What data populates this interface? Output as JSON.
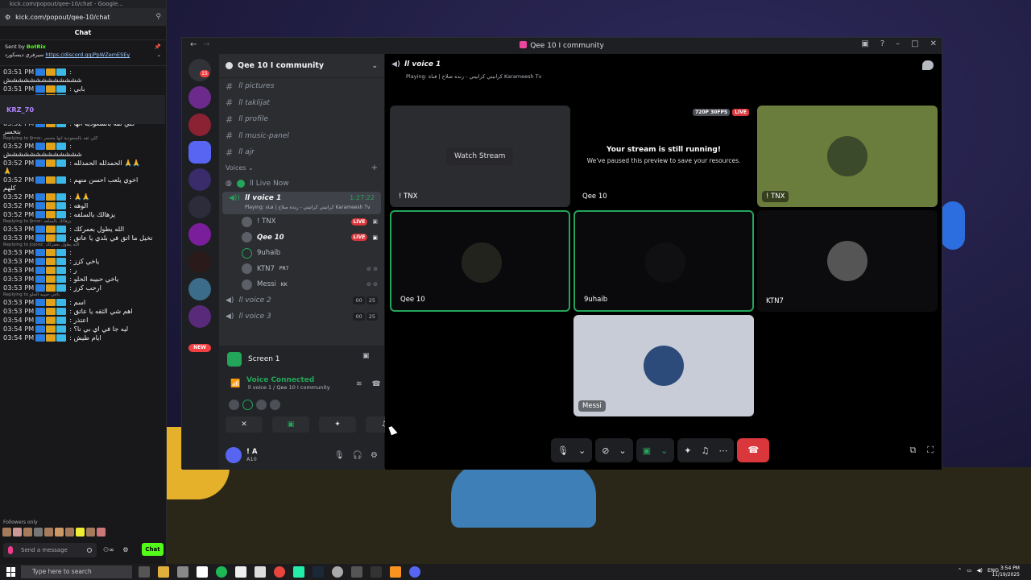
{
  "browser": {
    "title": "kick.com/popout/qee-10/chat - Google...",
    "url": "kick.com/popout/qee-10/chat"
  },
  "kick_chat": {
    "header": "Chat",
    "pinned_sender": "Sent by",
    "pinned_bot": "BotRix",
    "pinned_text": "سيرفري ديسكورد",
    "pinned_link": "https://discord.gg/PpWZemESEy",
    "messages": [
      {
        "time": "03:51 PM",
        "user": "Jojooz",
        "color": "#3aa0ff",
        "text": ":",
        "cont": "ششششششششششششش"
      },
      {
        "time": "03:51 PM",
        "user": "Jojooz",
        "color": "#3aa0ff",
        "text": ": بابي"
      },
      {
        "time": "03:51 PM",
        "user": "IJnno",
        "color": "#ffffff",
        "text": ": !!"
      },
      {
        "time": "03:51 PM",
        "user": "Jojooz",
        "color": "#3aa0ff",
        "text": ": ارحبي",
        "cont": "شششششششششششششش"
      },
      {
        "time": "03:52 PM",
        "user": "IJnno",
        "color": "#ffffff",
        "text": ": كلي ثقه بالسعودية انها",
        "cont": "بتخسر"
      },
      {
        "reply": "Replying to IJnno: كلي ثقه بالسعودية انها بتخسر",
        "time": "03:52 PM",
        "user": "Jojooz",
        "color": "#3aa0ff",
        "text": ":",
        "cont": "ششششششششششششش"
      },
      {
        "time": "03:52 PM",
        "user": "IJnno",
        "color": "#ffffff",
        "text": ": الحمدلله الحمدلله 🙏🙏",
        "cont": "🙏"
      },
      {
        "time": "03:52 PM",
        "user": "IJnno",
        "color": "#ffffff",
        "text": ": اخوي يلعب احسن منهم",
        "cont": "كلهم"
      },
      {
        "time": "03:52 PM",
        "user": "IJnno",
        "color": "#ffffff",
        "text": ": 🙏🙏"
      },
      {
        "time": "03:52 PM",
        "user": "Jojooz",
        "color": "#3aa0ff",
        "text": ": الوهه"
      },
      {
        "time": "03:52 PM",
        "user": "IJnno",
        "color": "#ffffff",
        "text": ": يزهالك بالسلفه"
      },
      {
        "reply": "Replying to IJnno: يزهالك بالسلفه",
        "time": "03:53 PM",
        "user": "Jojooz",
        "color": "#3aa0ff",
        "text": ": الله يطول بعمركك"
      },
      {
        "time": "03:53 PM",
        "user": "KRZ_70",
        "color": "#b084ff",
        "text": ": تخيل ما اتق في بلدي يا عاتق"
      },
      {
        "reply": "Replying to Jojooz: الله يطول بعمركك",
        "time": "03:53 PM",
        "user": "IJnno",
        "color": "#ffffff",
        "text": ":"
      },
      {
        "time": "03:53 PM",
        "user": "Jojooz",
        "color": "#3aa0ff",
        "text": ": ياخي كزز"
      },
      {
        "time": "03:53 PM",
        "user": "Jojooz",
        "color": "#3aa0ff",
        "text": ": ر"
      },
      {
        "time": "03:53 PM",
        "user": "Jojooz",
        "color": "#3aa0ff",
        "text": ": ياخي حبيبه الحلو"
      },
      {
        "time": "03:53 PM",
        "user": "IJnno",
        "color": "#ffffff",
        "text": ": ارحب كرز"
      },
      {
        "reply": "Replying to ياخي حبيبه الحلو",
        "time": "03:53 PM",
        "user": "Jojooz",
        "color": "#3aa0ff",
        "text": ": اسم"
      },
      {
        "time": "03:53 PM",
        "user": "KRZ_70",
        "color": "#b084ff",
        "text": ": اهم شي الثقه يا عاتق"
      },
      {
        "time": "03:54 PM",
        "user": "KRZ_70",
        "color": "#b084ff",
        "text": ": اعتذر"
      },
      {
        "time": "03:54 PM",
        "user": "IJnno",
        "color": "#ffffff",
        "text": ": ليه جا في اي بي نا؟"
      },
      {
        "time": "03:54 PM",
        "user": "KRZ_70",
        "color": "#b084ff",
        "text": ": ايام طيش"
      }
    ],
    "followers_only": "Followers only",
    "input_placeholder": "Send a message",
    "chat_button": "Chat"
  },
  "discord": {
    "window_title": "Qee 10 I community",
    "server_name": "Qee 10 I community",
    "rail_badge": "15",
    "rail_new": "NEW",
    "channels": [
      {
        "name": "ll pictures"
      },
      {
        "name": "ll taklijat"
      },
      {
        "name": "ll profile"
      },
      {
        "name": "ll music-panel"
      },
      {
        "name": "ll ajr"
      }
    ],
    "voices_label": "Voices",
    "live_now": "ll Live Now",
    "active_voice": {
      "name": "ll voice 1",
      "timer": "1:27:22",
      "playing": "Playing: كرانيتي كرانيتي - رنده صلاح | قناة Karameesh Tv"
    },
    "members": [
      {
        "name": "! TNX",
        "live": "LIVE"
      },
      {
        "name": "Qee 10",
        "live": "LIVE"
      },
      {
        "name": "9uhaib",
        "live": ""
      },
      {
        "name": "KTN7",
        "tag": "PR7"
      },
      {
        "name": "Messi",
        "tag": "KK"
      }
    ],
    "other_voices": [
      {
        "name": "ll voice 2",
        "a": "00",
        "b": "25"
      },
      {
        "name": "ll voice 3",
        "a": "00",
        "b": "25"
      }
    ],
    "screen_label": "Screen 1",
    "voice_connected": "Voice Connected",
    "voice_connected_sub": "ll voice 1 / Qee 10 I community",
    "user_name": "! A",
    "user_status": "A10",
    "stage": {
      "title": "ll voice 1",
      "playing": "Playing: كرانيتي كرانيتي - رنده صلاح | قناة Karameesh Tv",
      "watch_stream": "Watch Stream",
      "paused_title": "Your stream is still running!",
      "paused_sub": "We've paused this preview to save your resources.",
      "quality": "720P 30FPS",
      "live": "LIVE",
      "tiles": [
        "! TNX",
        "Qee 10",
        "! TNX",
        "Qee 10",
        "9uhaib",
        "KTN7",
        "Messi"
      ]
    }
  },
  "taskbar": {
    "search_placeholder": "Type here to search",
    "lang": "ENG",
    "time": "3:54 PM",
    "date": "11/19/2025"
  }
}
